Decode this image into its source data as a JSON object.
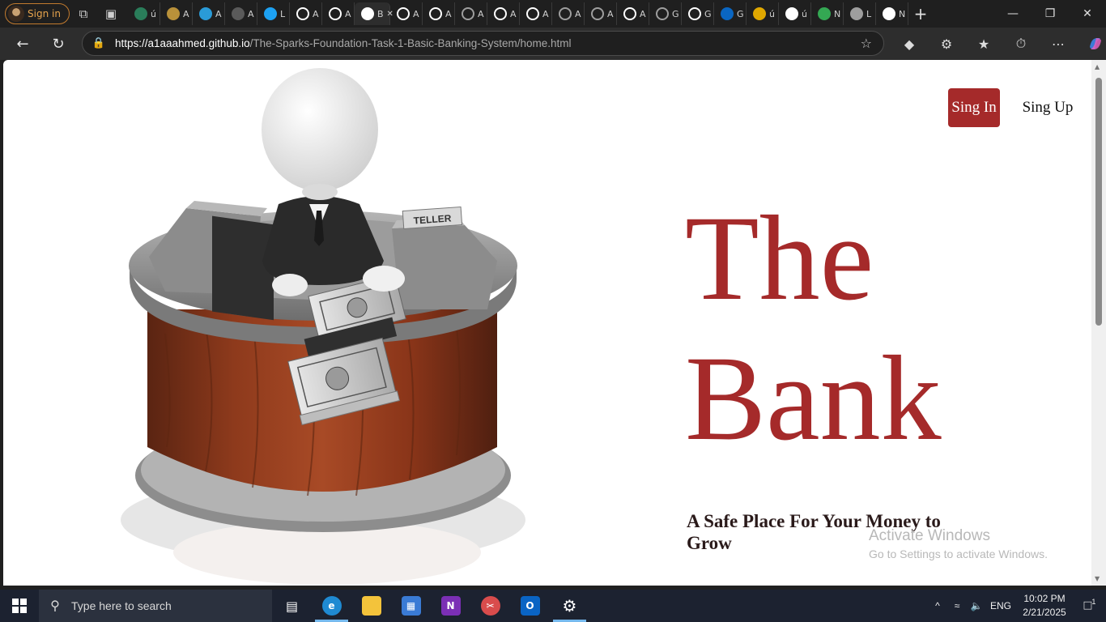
{
  "browser": {
    "profile_label": "Sign in",
    "tabs": [
      {
        "label": "ú",
        "icon": "generic-icon",
        "color": "#2a7d5a"
      },
      {
        "label": "A",
        "icon": "number-five-icon",
        "color": "#b9913a"
      },
      {
        "label": "A",
        "icon": "circle-blue-icon",
        "color": "#2a9bd8"
      },
      {
        "label": "A",
        "icon": "upwork-icon",
        "color": "#5a5a5a"
      },
      {
        "label": "L",
        "icon": "bird-icon",
        "color": "#1da1f2"
      },
      {
        "label": "A",
        "icon": "github-icon",
        "color": "#ffffff"
      },
      {
        "label": "A",
        "icon": "github-icon",
        "color": "#ffffff"
      },
      {
        "label": "B",
        "icon": "page-icon",
        "color": "#ffffff",
        "active": true
      },
      {
        "label": "A",
        "icon": "github-icon",
        "color": "#ffffff"
      },
      {
        "label": "A",
        "icon": "github-icon",
        "color": "#ffffff"
      },
      {
        "label": "A",
        "icon": "github-icon",
        "color": "#9e9e9e"
      },
      {
        "label": "A",
        "icon": "github-icon",
        "color": "#ffffff"
      },
      {
        "label": "A",
        "icon": "github-icon",
        "color": "#ffffff"
      },
      {
        "label": "A",
        "icon": "github-icon",
        "color": "#9e9e9e"
      },
      {
        "label": "A",
        "icon": "github-icon",
        "color": "#9e9e9e"
      },
      {
        "label": "A",
        "icon": "github-icon",
        "color": "#ffffff"
      },
      {
        "label": "G",
        "icon": "github-icon",
        "color": "#9e9e9e"
      },
      {
        "label": "G",
        "icon": "github-icon",
        "color": "#ffffff"
      },
      {
        "label": "G",
        "icon": "linkedin-icon",
        "color": "#0a66c2"
      },
      {
        "label": "ú",
        "icon": "number-five-icon",
        "color": "#e0a800"
      },
      {
        "label": "ú",
        "icon": "chatgpt-icon",
        "color": "#ffffff"
      },
      {
        "label": "N",
        "icon": "drive-icon",
        "color": "#34a853"
      },
      {
        "label": "L",
        "icon": "loading-icon",
        "color": "#9e9e9e"
      },
      {
        "label": "N",
        "icon": "window-icon",
        "color": "#ffffff"
      }
    ],
    "url_host": "https://a1aaahmed.github.io",
    "url_path": "/The-Sparks-Foundation-Task-1-Basic-Banking-System/home.html"
  },
  "page": {
    "signin_label": "Sing In",
    "signup_label": "Sing Up",
    "title_line1": "The",
    "title_line2": "Bank",
    "tagline": "A Safe Place For Your Money to Grow",
    "accent_color": "#a52a2a",
    "hero_sign": "TELLER"
  },
  "watermark": {
    "title": "Activate Windows",
    "subtitle": "Go to Settings to activate Windows."
  },
  "taskbar": {
    "search_placeholder": "Type here to search",
    "language": "ENG",
    "time": "10:02 PM",
    "date": "2/21/2025",
    "notification_count": "1"
  }
}
